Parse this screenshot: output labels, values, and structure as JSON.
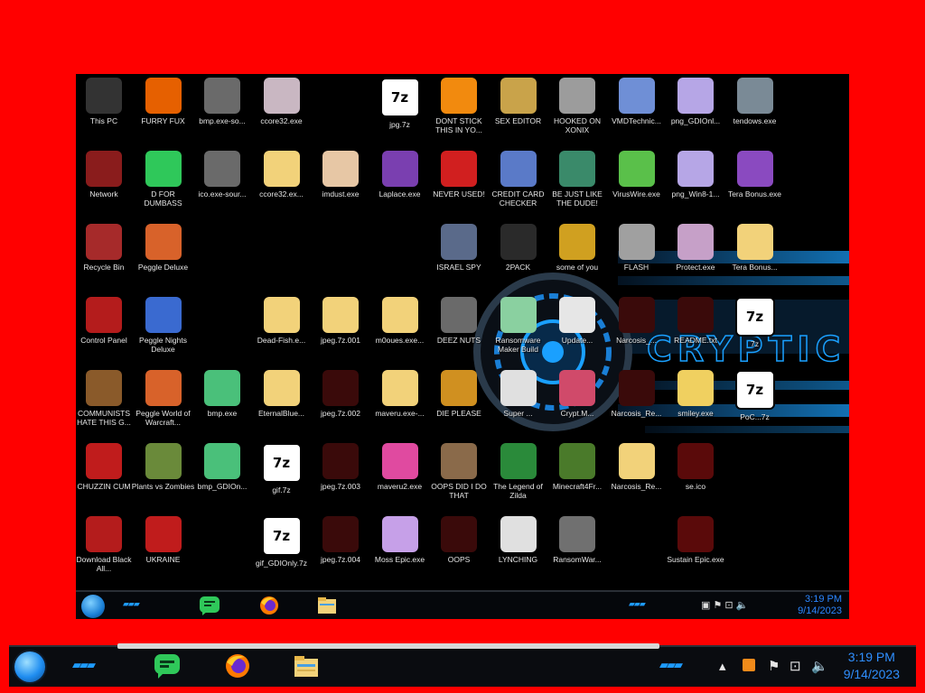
{
  "desktop_icons": [
    {
      "label": "This PC",
      "icon": "this-pc-icon",
      "bg": "#333"
    },
    {
      "label": "FURRY FUX",
      "icon": "firefox-icon",
      "bg": "#e66000"
    },
    {
      "label": "bmp.exe-so...",
      "icon": "broken-file-icon",
      "bg": "#6a6a6a"
    },
    {
      "label": "ccore32.exe",
      "icon": "face-image-icon",
      "bg": "#c9b7c2"
    },
    {
      "label": "jpg.7z",
      "icon": "7z-archive-icon",
      "bg": "#ffffff"
    },
    {
      "label": "DONT STICK THIS IN YO...",
      "icon": "vlc-cone-icon",
      "bg": "#f28a0e"
    },
    {
      "label": "SEX EDITOR",
      "icon": "hex-editor-icon",
      "bg": "#c9a34a"
    },
    {
      "label": "HOOKED ON XONIX",
      "icon": "xonix-game-icon",
      "bg": "#9c9c9c"
    },
    {
      "label": "VMDTechnic...",
      "icon": "technician-icon",
      "bg": "#6f8fd6"
    },
    {
      "label": "png_GDIOnl...",
      "icon": "anime-image-icon",
      "bg": "#b6a6e6"
    },
    {
      "label": "tendows.exe",
      "icon": "disc-icon",
      "bg": "#7a8a96"
    },
    {
      "label": "Network",
      "icon": "network-icon",
      "bg": "#8a1c1c"
    },
    {
      "label": "D FOR DUMBASS",
      "icon": "discord-green-icon",
      "bg": "#2fc85a"
    },
    {
      "label": "ico.exe-sour...",
      "icon": "broken-file-icon",
      "bg": "#6a6a6a"
    },
    {
      "label": "ccore32.ex...",
      "icon": "zip-folder-icon",
      "bg": "#f2d27a"
    },
    {
      "label": "imdust.exe",
      "icon": "palette-icon",
      "bg": "#e7c7a5"
    },
    {
      "label": "Laplace.exe",
      "icon": "gradient-icon",
      "bg": "#7a3fb0"
    },
    {
      "label": "NEVER USED!",
      "icon": "dev-cpp-icon",
      "bg": "#d11f1f"
    },
    {
      "label": "CREDIT CARD CHECKER",
      "icon": "credit-card-icon",
      "bg": "#5a7ac8"
    },
    {
      "label": "BE JUST LIKE THE DUDE!",
      "icon": "dude-icon",
      "bg": "#3a8a6a"
    },
    {
      "label": "VirusWire.exe",
      "icon": "virus-icon",
      "bg": "#5ac04a"
    },
    {
      "label": "png_Win8-1...",
      "icon": "anime-image-icon",
      "bg": "#b6a6e6"
    },
    {
      "label": "Tera Bonus.exe",
      "icon": "cloud-icon",
      "bg": "#8a4ac0"
    },
    {
      "label": "Recycle Bin",
      "icon": "recycle-bin-icon",
      "bg": "#a62a2a"
    },
    {
      "label": "Peggle Deluxe",
      "icon": "peggle-icon",
      "bg": "#d8622a"
    },
    {
      "label": "ISRAEL SPY",
      "icon": "spy-icon",
      "bg": "#5a6a8a"
    },
    {
      "label": "2PACK",
      "icon": "terminal-icon",
      "bg": "#2a2a2a"
    },
    {
      "label": "some of you",
      "icon": "dog-icon",
      "bg": "#d0a020"
    },
    {
      "label": "FLASH",
      "icon": "flash-cards-icon",
      "bg": "#a0a0a0"
    },
    {
      "label": "Protect.exe",
      "icon": "anime-image-icon",
      "bg": "#c6a0c8"
    },
    {
      "label": "Tera Bonus...",
      "icon": "zip-folder-icon",
      "bg": "#f2d27a"
    },
    {
      "label": "Control Panel",
      "icon": "control-panel-icon",
      "bg": "#b41c1c"
    },
    {
      "label": "Peggle Nights Deluxe",
      "icon": "peggle-nights-icon",
      "bg": "#3a6ad0"
    },
    {
      "label": "Dead-Fish.e...",
      "icon": "zip-folder-icon",
      "bg": "#f2d27a"
    },
    {
      "label": "jpeg.7z.001",
      "icon": "zip-folder-icon",
      "bg": "#f2d27a"
    },
    {
      "label": "m0oues.exe...",
      "icon": "zip-folder-icon",
      "bg": "#f2d27a"
    },
    {
      "label": "DEEZ NUTS",
      "icon": "stack-icon",
      "bg": "#6a6a6a"
    },
    {
      "label": "Ransomware Maker Build",
      "icon": "window-icon",
      "bg": "#8ad0a0"
    },
    {
      "label": "Update...",
      "icon": "document-icon",
      "bg": "#e6e6e6"
    },
    {
      "label": "Narcosis_...",
      "icon": "narcosis-icon",
      "bg": "#3a0a0a"
    },
    {
      "label": "README.txt",
      "icon": "narcosis-icon",
      "bg": "#3a0a0a"
    },
    {
      "label": "7z",
      "icon": "7z-archive-icon",
      "bg": "#ffffff"
    },
    {
      "label": "COMMUNISTS HATE THIS G...",
      "icon": "money-bag-icon",
      "bg": "#8a5a2a"
    },
    {
      "label": "Peggle World of Warcraft...",
      "icon": "peggle-icon",
      "bg": "#d8622a"
    },
    {
      "label": "bmp.exe",
      "icon": "image-icon",
      "bg": "#4ac07a"
    },
    {
      "label": "EternalBlue...",
      "icon": "zip-folder-icon",
      "bg": "#f2d27a"
    },
    {
      "label": "jpeg.7z.002",
      "icon": "narcosis-icon",
      "bg": "#3a0a0a"
    },
    {
      "label": "maveru.exe-...",
      "icon": "zip-folder-icon",
      "bg": "#f2d27a"
    },
    {
      "label": "DIE PLEASE",
      "icon": "de-icon",
      "bg": "#d09020"
    },
    {
      "label": "Super ...",
      "icon": "comic-icon",
      "bg": "#e0e0e0"
    },
    {
      "label": "Crypt.M...",
      "icon": "monitor-icon",
      "bg": "#d04a6a"
    },
    {
      "label": "Narcosis_Re...",
      "icon": "narcosis-icon",
      "bg": "#3a0a0a"
    },
    {
      "label": "smiley.exe",
      "icon": "smiley-icon",
      "bg": "#f0d060"
    },
    {
      "label": "PoC...7z",
      "icon": "7z-archive-icon",
      "bg": "#ffffff"
    },
    {
      "label": "CHUZZIN CUM",
      "icon": "chuzzle-icon",
      "bg": "#c01c1c"
    },
    {
      "label": "Plants vs Zombies",
      "icon": "pvz-icon",
      "bg": "#6a8a3a"
    },
    {
      "label": "bmp_GDIOn...",
      "icon": "image-icon",
      "bg": "#4ac07a"
    },
    {
      "label": "gif.7z",
      "icon": "7z-archive-icon",
      "bg": "#ffffff"
    },
    {
      "label": "jpeg.7z.003",
      "icon": "narcosis-icon",
      "bg": "#3a0a0a"
    },
    {
      "label": "maveru2.exe",
      "icon": "pattern-icon",
      "bg": "#e04aa0"
    },
    {
      "label": "OOPS DID I DO THAT",
      "icon": "portrait-icon",
      "bg": "#8a6a4a"
    },
    {
      "label": "The Legend of Zilda",
      "icon": "zelda-icon",
      "bg": "#2a8a3a"
    },
    {
      "label": "Minecraft4Fr...",
      "icon": "minecraft-icon",
      "bg": "#4a7a2a"
    },
    {
      "label": "Narcosis_Re...",
      "icon": "zip-folder-icon",
      "bg": "#f2d27a"
    },
    {
      "label": "se.ico",
      "icon": "dark-face-icon",
      "bg": "#5a0a0a"
    },
    {
      "label": "Download Black All...",
      "icon": "download-icon",
      "bg": "#b41c1c"
    },
    {
      "label": "UKRAINE",
      "icon": "radiation-icon",
      "bg": "#c01c1c"
    },
    {
      "label": "gif_GDIOnly.7z",
      "icon": "7z-archive-icon",
      "bg": "#ffffff"
    },
    {
      "label": "jpeg.7z.004",
      "icon": "narcosis-icon",
      "bg": "#3a0a0a"
    },
    {
      "label": "Moss Epic.exe",
      "icon": "anime-image-icon",
      "bg": "#c6a0e8"
    },
    {
      "label": "OOPS",
      "icon": "narcosis-icon",
      "bg": "#3a0a0a"
    },
    {
      "label": "LYNCHING",
      "icon": "warning-icon",
      "bg": "#e0e0e0"
    },
    {
      "label": "RansomWar...",
      "icon": "skull-icon",
      "bg": "#707070"
    },
    {
      "label": "Sustain Epic.exe",
      "icon": "dark-face-icon",
      "bg": "#5a0a0a"
    }
  ],
  "wallpaper": {
    "text": "CRYPTIC",
    "accent": "#1aa0ff"
  },
  "inner_taskbar": {
    "apps": [
      {
        "icon": "discord-green-icon"
      },
      {
        "icon": "firefox-icon"
      },
      {
        "icon": "file-explorer-icon"
      }
    ],
    "time": "3:19 PM",
    "date": "9/14/2023"
  },
  "taskbar": {
    "apps": [
      {
        "icon": "discord-green-icon"
      },
      {
        "icon": "firefox-icon"
      },
      {
        "icon": "file-explorer-icon"
      }
    ],
    "tray": [
      "overflow-icon",
      "orange-app-icon",
      "flag-icon",
      "network-icon",
      "volume-icon"
    ],
    "time": "3:19 PM",
    "date": "9/14/2023"
  },
  "colors": {
    "frame": "#ff0000",
    "clock": "#2f8fff",
    "accent": "#1e9bff"
  }
}
